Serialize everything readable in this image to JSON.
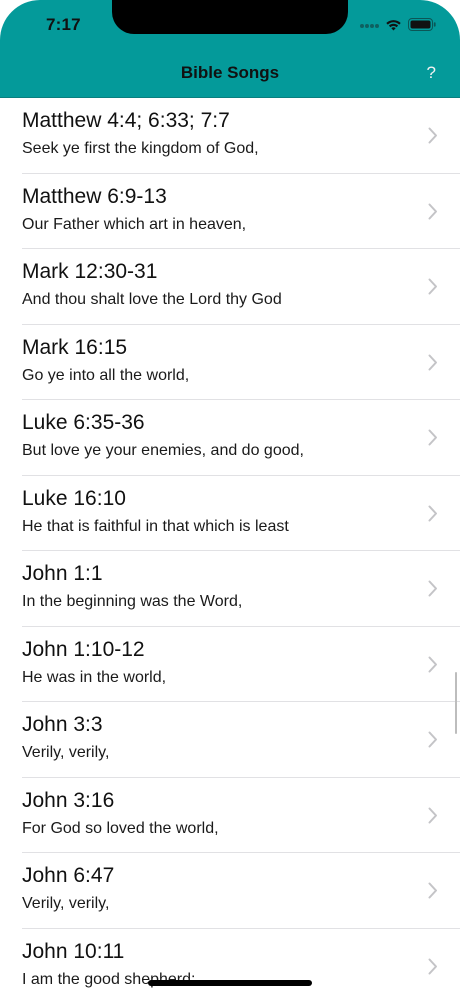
{
  "status_bar": {
    "time": "7:17",
    "icons": [
      "signal-icon",
      "wifi-icon",
      "battery-icon"
    ]
  },
  "nav": {
    "title": "Bible Songs",
    "help_label": "?"
  },
  "colors": {
    "header_bg": "#049A9A",
    "title_text": "#111111",
    "chevron": "#c4c4c7",
    "separator": "#e1e1e4"
  },
  "songs": [
    {
      "ref": "Matthew 4:4; 6:33; 7:7",
      "snippet": "Seek ye first the kingdom of God,"
    },
    {
      "ref": "Matthew 6:9-13",
      "snippet": "Our Father which art in heaven,"
    },
    {
      "ref": "Mark 12:30-31",
      "snippet": "And thou shalt love the Lord thy God"
    },
    {
      "ref": "Mark 16:15",
      "snippet": "Go ye into all the world,"
    },
    {
      "ref": "Luke 6:35-36",
      "snippet": "But love ye your enemies, and do good,"
    },
    {
      "ref": "Luke 16:10",
      "snippet": "He that is faithful in that which is least"
    },
    {
      "ref": "John 1:1",
      "snippet": "In the beginning was the Word,"
    },
    {
      "ref": "John 1:10-12",
      "snippet": "He was in the world,"
    },
    {
      "ref": "John 3:3",
      "snippet": "Verily, verily,"
    },
    {
      "ref": "John 3:16",
      "snippet": "For God so loved the world,"
    },
    {
      "ref": "John 6:47",
      "snippet": "Verily, verily,"
    },
    {
      "ref": "John 10:11",
      "snippet": "I am the good shepherd:"
    }
  ]
}
